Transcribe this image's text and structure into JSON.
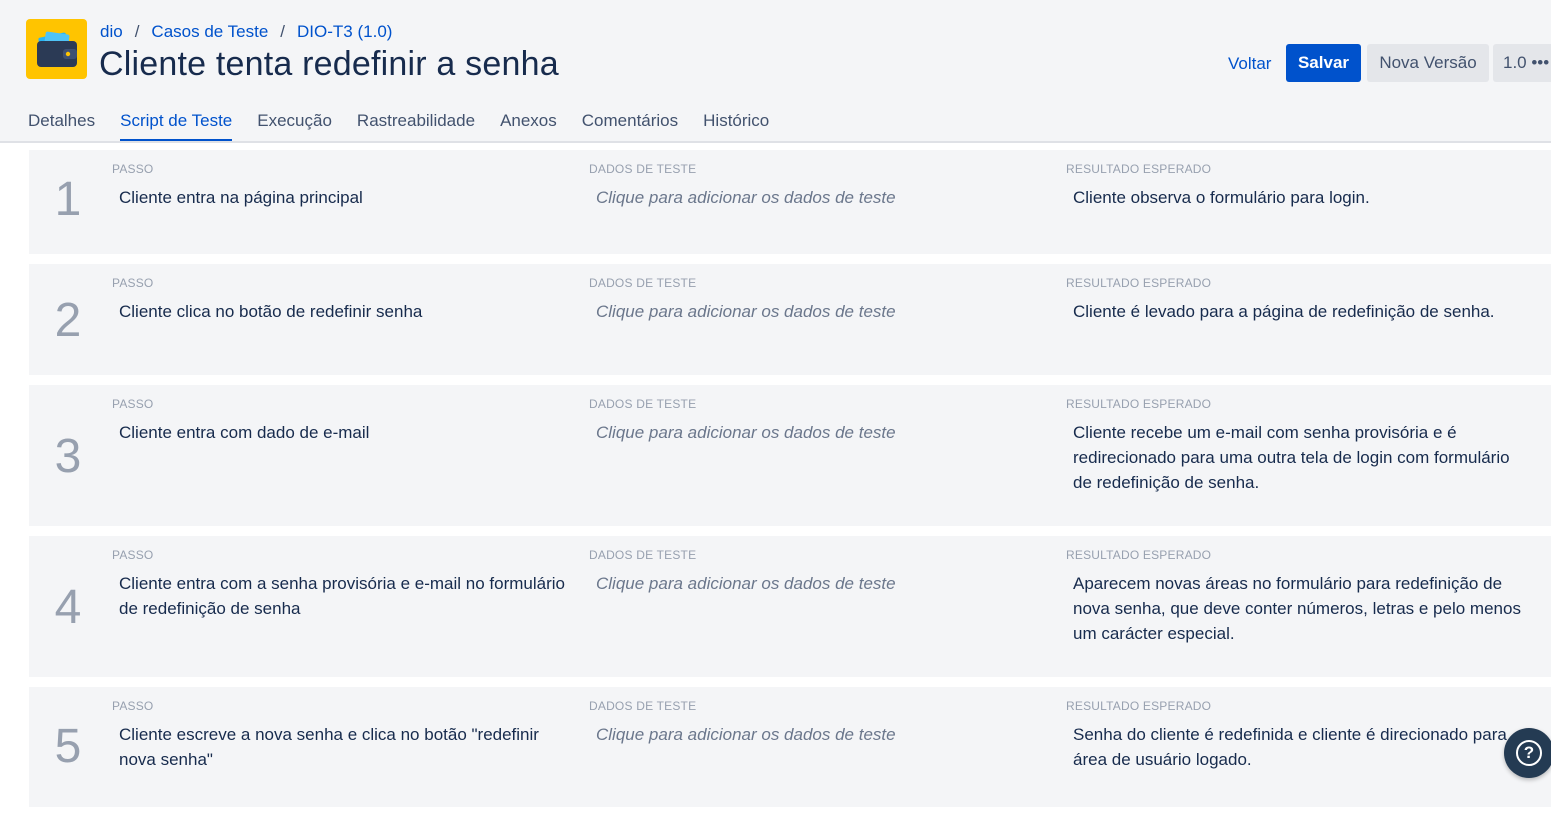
{
  "breadcrumb": [
    "dio",
    "Casos de Teste",
    "DIO-T3 (1.0)"
  ],
  "page_title": "Cliente tenta redefinir a senha",
  "actions": {
    "back": "Voltar",
    "save": "Salvar",
    "new_version": "Nova Versão",
    "version": "1.0 •••"
  },
  "tabs": [
    {
      "label": "Detalhes",
      "active": false
    },
    {
      "label": "Script de Teste",
      "active": true
    },
    {
      "label": "Execução",
      "active": false
    },
    {
      "label": "Rastreabilidade",
      "active": false
    },
    {
      "label": "Anexos",
      "active": false
    },
    {
      "label": "Comentários",
      "active": false
    },
    {
      "label": "Histórico",
      "active": false
    }
  ],
  "column_labels": {
    "step": "PASSO",
    "data": "DADOS DE TESTE",
    "expected": "RESULTADO ESPERADO"
  },
  "steps": [
    {
      "number": "1",
      "step": "Cliente entra na página principal",
      "data": "Clique para adicionar os dados de teste",
      "expected": "Cliente observa o formulário para login."
    },
    {
      "number": "2",
      "step": "Cliente clica no botão de redefinir senha",
      "data": "Clique para adicionar os dados de teste",
      "expected": "Cliente é levado para a página de redefinição de senha."
    },
    {
      "number": "3",
      "step": "Cliente entra com dado de e-mail",
      "data": "Clique para adicionar os dados de teste",
      "expected": "Cliente recebe um e-mail com senha provisória e é redirecionado para uma outra tela de login com formulário de redefinição de senha."
    },
    {
      "number": "4",
      "step": "Cliente entra com a senha provisória e e-mail no formulário de redefinição de senha",
      "data": "Clique para adicionar os dados de teste",
      "expected": "Aparecem novas áreas no formulário para redefinição de nova senha, que deve conter números, letras e pelo menos um carácter especial."
    },
    {
      "number": "5",
      "step": "Cliente escreve a nova senha e clica no botão \"redefinir nova senha\"",
      "data": "Clique para adicionar os dados de teste",
      "expected": "Senha do cliente é redefinida e cliente é direcionado para área de usuário logado."
    }
  ],
  "help": {
    "icon": "question-icon",
    "glyph": "?"
  },
  "colors": {
    "accent": "#0052cc",
    "logo_bg": "#ffc400",
    "row_bg": "#f4f5f7"
  }
}
